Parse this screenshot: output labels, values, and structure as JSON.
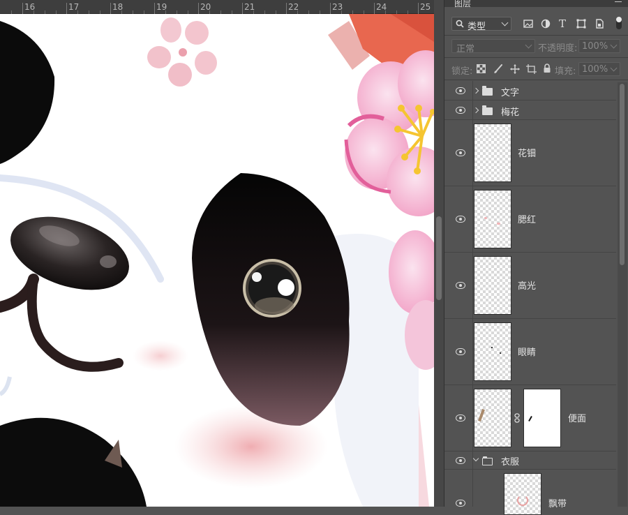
{
  "ruler": {
    "labels": [
      "16",
      "17",
      "18",
      "19",
      "20",
      "21",
      "22",
      "23",
      "24",
      "25"
    ]
  },
  "panel": {
    "tab_title": "图层",
    "filter": {
      "kind_label": "类型",
      "icons": [
        "image-filter-icon",
        "adjustment-filter-icon",
        "type-filter-icon",
        "shape-filter-icon",
        "smart-object-filter-icon"
      ]
    },
    "blend_mode": "正常",
    "opacity_label": "不透明度:",
    "opacity_value": "100%",
    "lock_label": "锁定:",
    "fill_label": "填充:",
    "fill_value": "100%",
    "layers": [
      {
        "name": "文字",
        "type": "group",
        "expanded": false
      },
      {
        "name": "梅花",
        "type": "group",
        "expanded": false
      },
      {
        "name": "花钿",
        "type": "layer"
      },
      {
        "name": "腮红",
        "type": "layer"
      },
      {
        "name": "高光",
        "type": "layer"
      },
      {
        "name": "眼睛",
        "type": "layer"
      },
      {
        "name": "便面",
        "type": "layer",
        "has_mask": true
      },
      {
        "name": "衣服",
        "type": "group",
        "expanded": true
      },
      {
        "name": "飘带",
        "type": "layer",
        "indented": true
      }
    ]
  },
  "colors": {
    "panel_bg": "#535353",
    "ruler_bg": "#3e3e3e",
    "blossom_pink": "#f3a9cc",
    "stamen_yellow": "#f5c531",
    "blush": "#f1b3b6",
    "ribbon_red": "#e8674f"
  }
}
